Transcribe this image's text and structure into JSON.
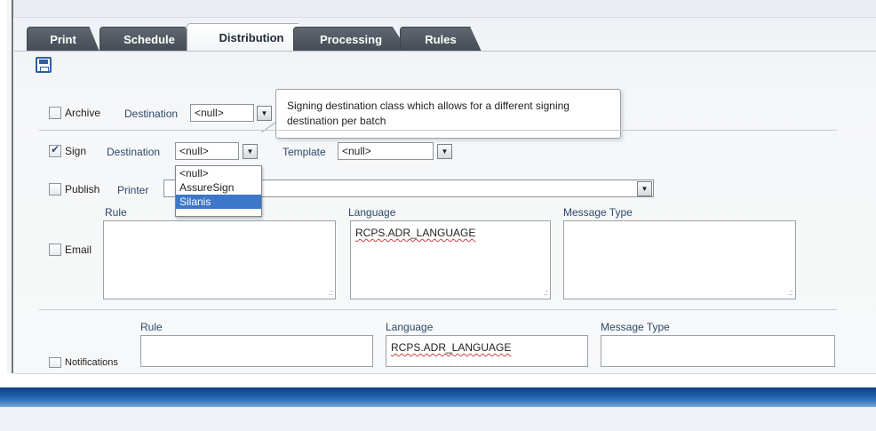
{
  "tabs": [
    {
      "label": "Print"
    },
    {
      "label": "Schedule"
    },
    {
      "label": "Distribution"
    },
    {
      "label": "Processing"
    },
    {
      "label": "Rules"
    }
  ],
  "active_tab": "Distribution",
  "archive": {
    "checkbox_label": "Archive",
    "checked": false,
    "destination_label": "Destination",
    "destination_value": "<null>"
  },
  "tooltip": {
    "text": "Signing destination class which allows for a different signing destination per batch"
  },
  "sign": {
    "checkbox_label": "Sign",
    "checked": true,
    "destination_label": "Destination",
    "destination_value": "<null>",
    "template_label": "Template",
    "template_value": "<null>"
  },
  "dropdown": {
    "options": [
      "<null>",
      "AssureSign",
      "Silanis"
    ],
    "highlighted": "Silanis"
  },
  "publish": {
    "checkbox_label": "Publish",
    "checked": false,
    "printer_label": "Printer",
    "printer_value": ""
  },
  "email": {
    "checkbox_label": "Email",
    "checked": false,
    "rule_label": "Rule",
    "language_label": "Language",
    "language_value": "RCPS.ADR_LANGUAGE",
    "message_type_label": "Message Type"
  },
  "notifications": {
    "checkbox_label": "Notifications",
    "checked": false,
    "rule_label": "Rule",
    "language_label": "Language",
    "language_value": "RCPS.ADR_LANGUAGE",
    "message_type_label": "Message Type"
  },
  "colors": {
    "tab_dark": "#4e5660",
    "bottom_band": "#1d5da7",
    "dropdown_highlight": "#3e77c7"
  }
}
